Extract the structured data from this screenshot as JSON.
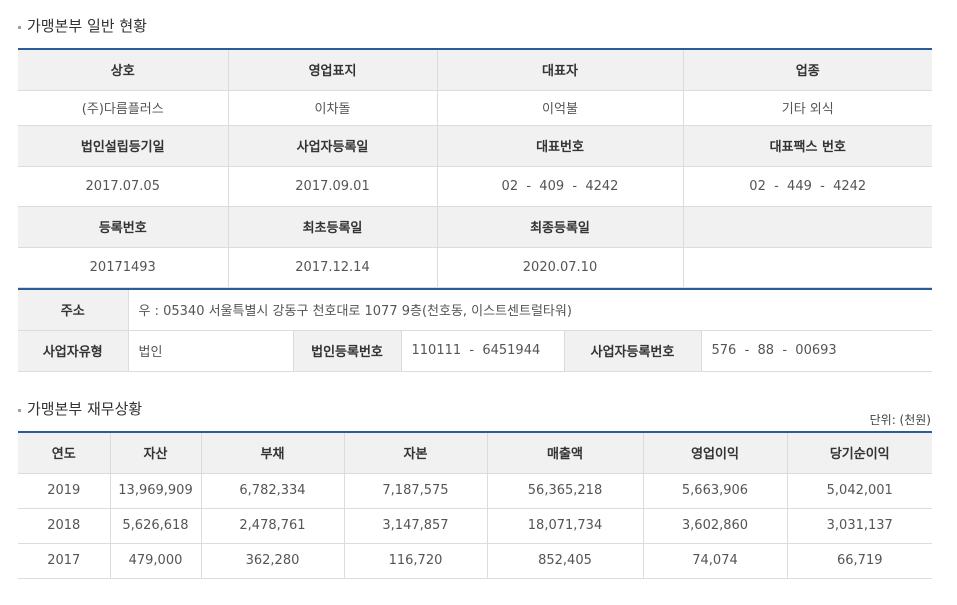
{
  "general": {
    "title": "가맹본부 일반 현황",
    "rows": [
      {
        "header": [
          "상호",
          "영업표지",
          "대표자",
          "업종"
        ],
        "value": [
          "(주)다름플러스",
          "이차돌",
          "이억불",
          "기타 외식"
        ]
      },
      {
        "header": [
          "법인설립등기일",
          "사업자등록일",
          "대표번호",
          "대표팩스 번호"
        ],
        "value": [
          "2017.07.05",
          "2017.09.01",
          "02  -  409  -  4242",
          "02  -  449  -  4242"
        ]
      },
      {
        "header": [
          "등록번호",
          "최초등록일",
          "최종등록일",
          ""
        ],
        "value": [
          "20171493",
          "2017.12.14",
          "2020.07.10",
          ""
        ]
      }
    ]
  },
  "address": {
    "label": "주소",
    "value": "우 : 05340 서울특별시 강동구 천호대로 1077 9층(천호동, 이스트센트럴타워)"
  },
  "business": {
    "type_label": "사업자유형",
    "type_value": "법인",
    "corp_label": "법인등록번호",
    "corp_value": "110111  -  6451944",
    "biz_label": "사업자등록번호",
    "biz_value": "576  -  88  -  00693"
  },
  "finance": {
    "title": "가맹본부 재무상황",
    "unit": "단위: (천원)",
    "columns": [
      "연도",
      "자산",
      "부채",
      "자본",
      "매출액",
      "영업이익",
      "당기순이익"
    ],
    "rows": [
      [
        "2019",
        "13,969,909",
        "6,782,334",
        "7,187,575",
        "56,365,218",
        "5,663,906",
        "5,042,001"
      ],
      [
        "2018",
        "5,626,618",
        "2,478,761",
        "3,147,857",
        "18,071,734",
        "3,602,860",
        "3,031,137"
      ],
      [
        "2017",
        "479,000",
        "362,280",
        "116,720",
        "852,405",
        "74,074",
        "66,719"
      ]
    ]
  }
}
